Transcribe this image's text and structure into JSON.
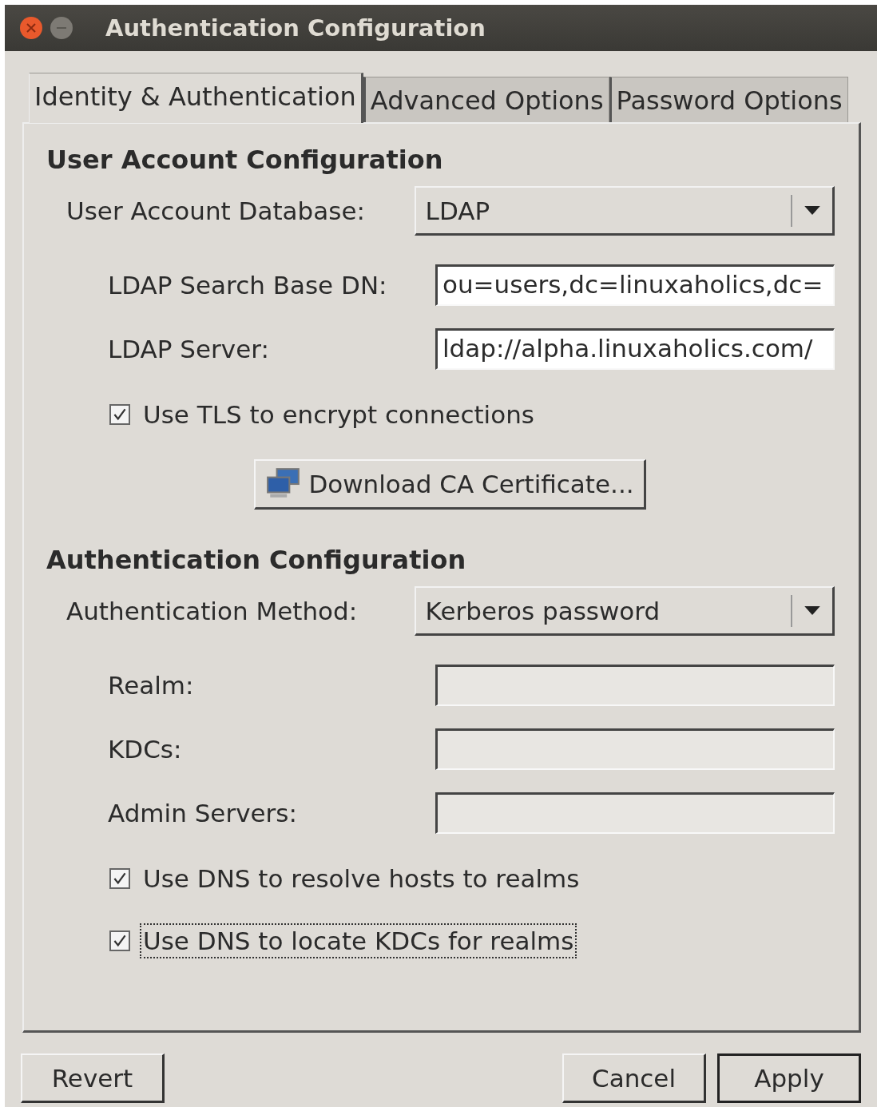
{
  "window": {
    "title": "Authentication Configuration"
  },
  "tabs": [
    {
      "label": "Identity & Authentication",
      "selected": true
    },
    {
      "label": "Advanced Options",
      "selected": false
    },
    {
      "label": "Password Options",
      "selected": false
    }
  ],
  "sections": [
    {
      "title": "User Account Configuration",
      "rows": [
        {
          "kind": "combo",
          "label": "User Account Database:",
          "value": "LDAP"
        },
        {
          "kind": "entries",
          "items": [
            {
              "label": "LDAP Search Base DN:",
              "value": "ou=users,dc=linuxaholics,dc=",
              "disabled": false
            },
            {
              "label": "LDAP Server:",
              "value": "ldap://alpha.linuxaholics.com/",
              "disabled": false
            }
          ]
        },
        {
          "kind": "checkbox",
          "label": "Use TLS to encrypt connections",
          "checked": true,
          "focused": false
        },
        {
          "kind": "button",
          "label": "Download CA Certificate..."
        }
      ]
    },
    {
      "title": "Authentication Configuration",
      "rows": [
        {
          "kind": "combo",
          "label": "Authentication Method:",
          "value": "Kerberos password"
        },
        {
          "kind": "entries",
          "items": [
            {
              "label": "Realm:",
              "disabled": true
            },
            {
              "label": "KDCs:",
              "disabled": true
            },
            {
              "label": "Admin Servers:",
              "disabled": true
            }
          ]
        },
        {
          "kind": "checkbox",
          "label": "Use DNS to resolve hosts to realms",
          "checked": true,
          "focused": false
        },
        {
          "kind": "checkbox",
          "label": "Use DNS to locate KDCs for realms",
          "checked": true,
          "focused": true
        }
      ]
    }
  ],
  "buttons": [
    {
      "label": "Revert",
      "default": false
    },
    {
      "label": "Cancel",
      "default": false
    },
    {
      "label": "Apply",
      "default": true
    }
  ]
}
